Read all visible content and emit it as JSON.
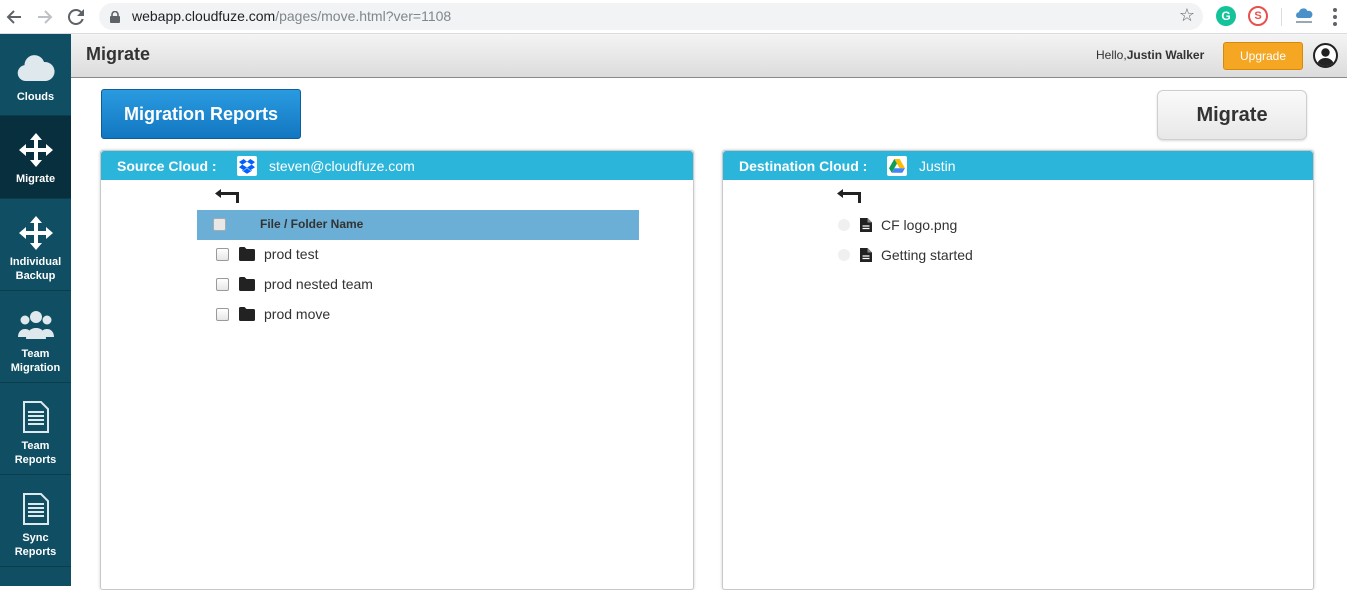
{
  "browser": {
    "url_host": "webapp.cloudfuze.com",
    "url_path": "/pages/move.html?ver=1108"
  },
  "sidebar": {
    "items": [
      {
        "label": "Clouds",
        "icon": "cloud-icon",
        "active": false
      },
      {
        "label": "Migrate",
        "icon": "move-arrows-icon",
        "active": true
      },
      {
        "label": "Individual Backup",
        "icon": "move-arrows-icon",
        "active": false
      },
      {
        "label": "Team Migration",
        "icon": "team-icon",
        "active": false
      },
      {
        "label": "Team Reports",
        "icon": "document-icon",
        "active": false
      },
      {
        "label": "Sync Reports",
        "icon": "document-icon",
        "active": false
      }
    ]
  },
  "header": {
    "title": "Migrate",
    "hello_prefix": "Hello,",
    "user_name": "Justin Walker",
    "upgrade_label": "Upgrade"
  },
  "main": {
    "reports_button": "Migration Reports",
    "migrate_button": "Migrate"
  },
  "source": {
    "label": "Source Cloud :",
    "account": "steven@cloudfuze.com",
    "column_header": "File / Folder Name",
    "items": [
      {
        "name": "prod test",
        "type": "folder"
      },
      {
        "name": "prod nested team",
        "type": "folder"
      },
      {
        "name": "prod move",
        "type": "folder"
      }
    ]
  },
  "destination": {
    "label": "Destination Cloud :",
    "account": "Justin",
    "items": [
      {
        "name": "CF logo.png",
        "type": "file"
      },
      {
        "name": "Getting started",
        "type": "file"
      }
    ]
  },
  "colors": {
    "sidebar_bg": "#0f4e63",
    "sidebar_active": "#082f3d",
    "panel_header": "#2cb5da",
    "table_header": "#6baed6",
    "upgrade": "#f5a623",
    "primary_button": "#1a88d0"
  }
}
